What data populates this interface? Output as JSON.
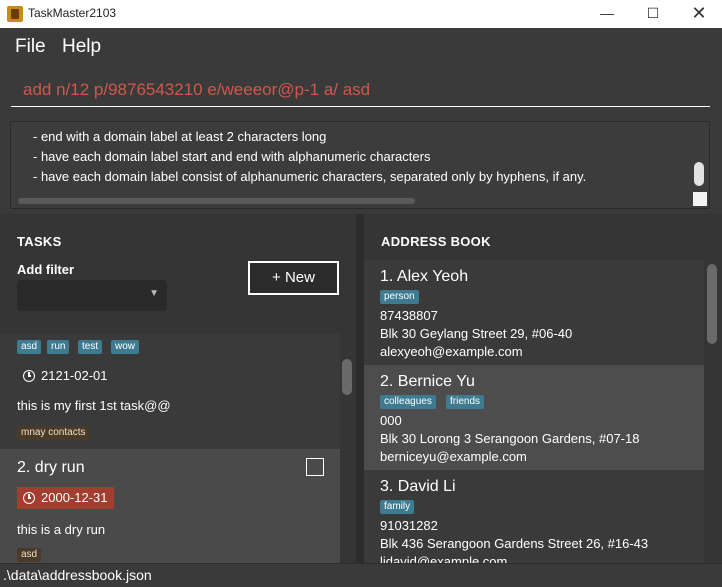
{
  "window": {
    "title": "TaskMaster2103",
    "minimize": "—",
    "maximize": "☐",
    "close": "✕"
  },
  "menu": {
    "file": "File",
    "help": "Help"
  },
  "command": {
    "value": "add n/12 p/9876543210 e/weeeor@p-1 a/ asd"
  },
  "result": {
    "lines": [
      "- end with a domain label at least 2 characters long",
      "- have each domain label start and end with alphanumeric characters",
      "- have each domain label consist of alphanumeric characters, separated only by hyphens, if any."
    ]
  },
  "tasks": {
    "heading": "TASKS",
    "filter_label": "Add filter",
    "new_button": "+ New",
    "items": [
      {
        "tags": [
          "asd",
          "run",
          "test",
          "wow"
        ],
        "date": "2121-02-01",
        "description": "this is my first 1st task@@",
        "contacts": [
          "mnay contacts"
        ]
      },
      {
        "title": "2.  dry run",
        "date": "2000-12-31",
        "description": "this is a dry run",
        "contacts": [
          "asd"
        ]
      }
    ]
  },
  "address_book": {
    "heading": "ADDRESS BOOK",
    "persons": [
      {
        "name": "1.  Alex Yeoh",
        "tags": [
          "person"
        ],
        "phone": "87438807",
        "address": "Blk 30 Geylang Street 29, #06-40",
        "email": "alexyeoh@example.com"
      },
      {
        "name": "2.  Bernice Yu",
        "tags": [
          "colleagues",
          "friends"
        ],
        "phone": "000",
        "address": "Blk 30 Lorong 3 Serangoon Gardens, #07-18",
        "email": "berniceyu@example.com"
      },
      {
        "name": "3.  David Li",
        "tags": [
          "family"
        ],
        "phone": "91031282",
        "address": "Blk 436 Serangoon Gardens Street 26, #16-43",
        "email": "lidavid@example.com"
      }
    ]
  },
  "status": {
    "path": ".\\data\\addressbook.json"
  },
  "colors": {
    "background": "#3a3a3a",
    "command_text": "#d0574a",
    "tag": "#3e7b91",
    "overdue": "#a23e2f"
  }
}
